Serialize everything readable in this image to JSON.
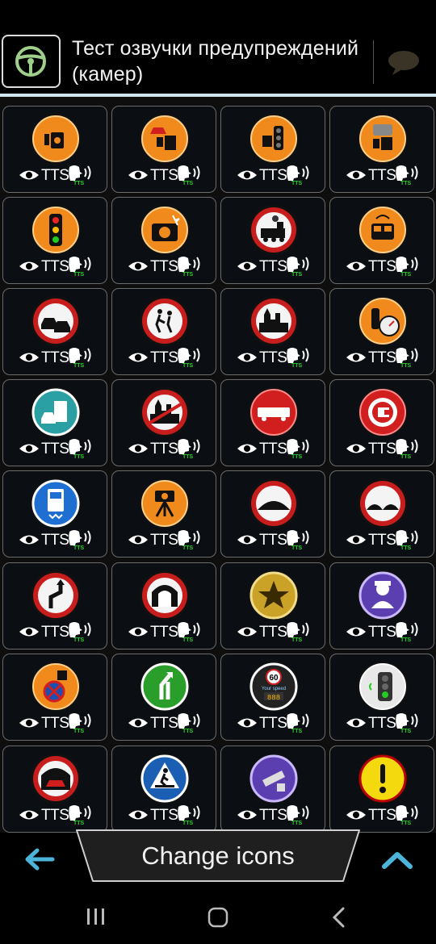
{
  "header": {
    "title": "Тест озвучки предупреждений (камер)",
    "icons": [
      "steering-wheel-icon",
      "chat-bubble-icon"
    ]
  },
  "cell_label": "TTS",
  "cell_badge": "TTS",
  "icons": [
    {
      "name": "speed-camera-icon",
      "bg": "orange"
    },
    {
      "name": "speed-camera-car-icon",
      "bg": "orange"
    },
    {
      "name": "traffic-light-camera-icon",
      "bg": "orange"
    },
    {
      "name": "mobile-camera-icon",
      "bg": "orange"
    },
    {
      "name": "traffic-light-icon",
      "bg": "orange"
    },
    {
      "name": "photo-camera-icon",
      "bg": "orange"
    },
    {
      "name": "railway-crossing-icon",
      "bg": "redring"
    },
    {
      "name": "bus-lane-camera-icon",
      "bg": "orange"
    },
    {
      "name": "accident-icon",
      "bg": "redring"
    },
    {
      "name": "children-icon",
      "bg": "redring"
    },
    {
      "name": "city-start-icon",
      "bg": "redring"
    },
    {
      "name": "traffic-light-speedometer-icon",
      "bg": "orange"
    },
    {
      "name": "toll-road-icon",
      "bg": "teal"
    },
    {
      "name": "city-end-icon",
      "bg": "redring"
    },
    {
      "name": "truck-restriction-icon",
      "bg": "red"
    },
    {
      "name": "congestion-charge-icon",
      "bg": "red"
    },
    {
      "name": "truck-weight-icon",
      "bg": "blue"
    },
    {
      "name": "tripod-camera-icon",
      "bg": "orange"
    },
    {
      "name": "speed-bump-icon",
      "bg": "redring"
    },
    {
      "name": "speed-bump-double-icon",
      "bg": "redring"
    },
    {
      "name": "dangerous-curve-icon",
      "bg": "redring"
    },
    {
      "name": "tunnel-icon",
      "bg": "redring"
    },
    {
      "name": "favorite-star-icon",
      "bg": "gold"
    },
    {
      "name": "police-icon",
      "bg": "purple"
    },
    {
      "name": "no-stopping-camera-icon",
      "bg": "orange"
    },
    {
      "name": "lane-change-icon",
      "bg": "green"
    },
    {
      "name": "your-speed-icon",
      "bg": "dark"
    },
    {
      "name": "green-light-icon",
      "bg": "gray"
    },
    {
      "name": "tunnel-car-icon",
      "bg": "redring"
    },
    {
      "name": "pedestrian-crossing-icon",
      "bg": "bluesq"
    },
    {
      "name": "wall-camera-icon",
      "bg": "purple"
    },
    {
      "name": "exclamation-warning-icon",
      "bg": "yellow"
    }
  ],
  "your_speed": {
    "limit": "60",
    "caption": "Your speed",
    "digits": "888"
  },
  "footer": {
    "change_label": "Change icons",
    "icons": [
      "back-arrow-icon",
      "chevron-up-icon"
    ]
  },
  "navbar": {
    "icons": [
      "recent-apps-icon",
      "home-icon",
      "back-icon"
    ]
  },
  "colors": {
    "accent": "#4bb4d8",
    "bluebar": "#cfe6f0",
    "badge": "#2bd12b",
    "orange": "#f08a1c",
    "red": "#d11f1f"
  }
}
